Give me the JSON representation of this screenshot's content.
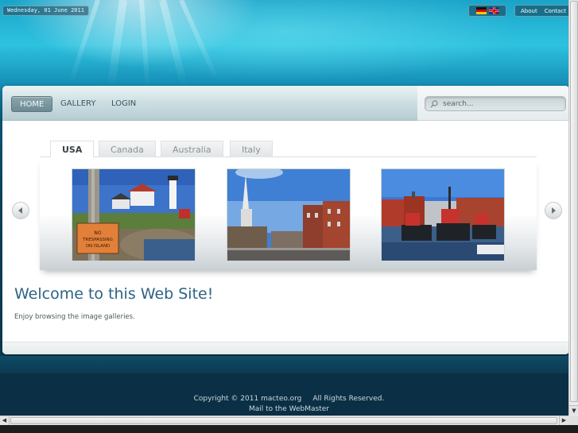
{
  "topbar": {
    "date": "Wednesday, 01 June 2011",
    "links": [
      "About",
      "Contact"
    ],
    "languages": [
      "Deutsch",
      "English"
    ]
  },
  "nav": {
    "items": [
      "HOME",
      "GALLERY",
      "LOGIN"
    ],
    "active": "HOME"
  },
  "search": {
    "placeholder": "search..."
  },
  "gallery": {
    "tabs": [
      "USA",
      "Canada",
      "Australia",
      "Italy"
    ],
    "active_tab": "USA",
    "thumbnails": [
      {
        "subject": "lighthouse",
        "sign_text": "NO TRESPASSING ON ISLAND"
      },
      {
        "subject": "church-street"
      },
      {
        "subject": "tugboats-harbor"
      }
    ]
  },
  "content": {
    "heading": "Welcome to this Web Site!",
    "intro": "Enjoy browsing the image galleries."
  },
  "footer": {
    "copyright": "Copyright © 2011 macteo.org",
    "rights": "All Rights Reserved.",
    "mail": "Mail to the WebMaster"
  },
  "colors": {
    "heading": "#2d6385",
    "footer_bg": "#0b3045",
    "water": "#1691b8"
  }
}
